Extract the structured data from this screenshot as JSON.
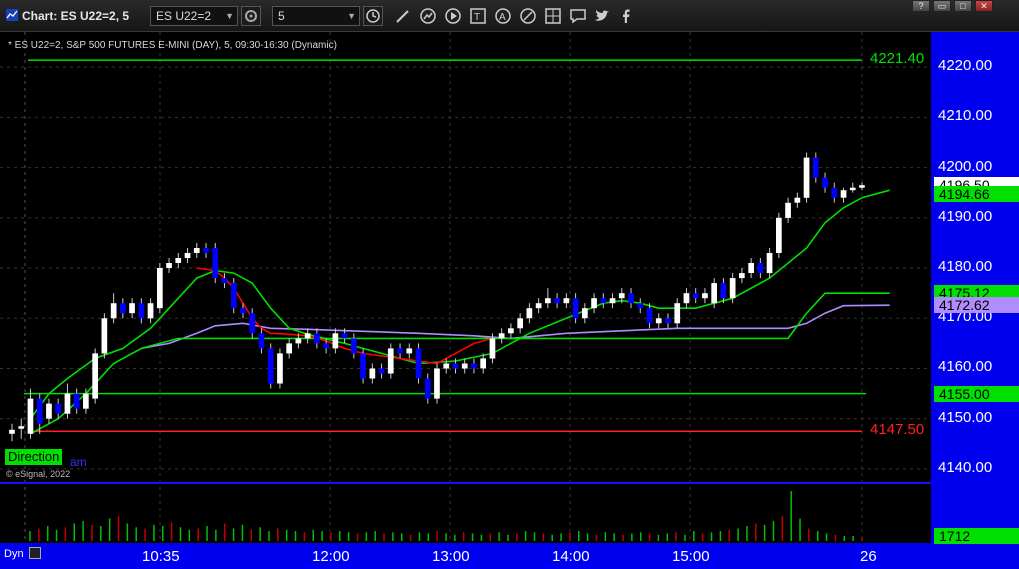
{
  "window": {
    "title": "Chart: ES U22=2, 5",
    "symbol_field": "ES U22=2",
    "interval_field": "5",
    "buttons": [
      "?",
      "▭",
      "□",
      "✕"
    ]
  },
  "chart": {
    "description": "* ES U22=2, S&P 500 FUTURES E-MINI (DAY), 5, 09:30-16:30 (Dynamic)",
    "credit": "© eSignal, 2022",
    "direction_label": "Direction",
    "direction_trail": "am",
    "dyn_label": "Dyn",
    "colors": {
      "background": "#000000",
      "axis": "#0000ee",
      "up_candle": "#ffffff",
      "down_candle": "#0000ff",
      "ma_fast": "#ff0000",
      "ma_green": "#00e000",
      "ma_purple": "#b08cff",
      "level_green": "#00e000",
      "level_red": "#ff2020"
    }
  },
  "chart_data": {
    "type": "candlestick",
    "y_ticks": [
      "4220.00",
      "4210.00",
      "4200.00",
      "4190.00",
      "4180.00",
      "4170.00",
      "4160.00",
      "4150.00",
      "4140.00"
    ],
    "ylim": [
      4137,
      4227
    ],
    "x_ticks": [
      "10:35",
      "12:00",
      "13:00",
      "14:00",
      "15:00",
      "26"
    ],
    "price_flags": [
      {
        "label": "4196.50",
        "bg": "#ffffff",
        "fg": "#000000"
      },
      {
        "label": "4194.66",
        "bg": "#00e000",
        "fg": "#000000"
      },
      {
        "label": "4175.12",
        "bg": "#00e000",
        "fg": "#000000"
      },
      {
        "label": "4172.62",
        "bg": "#b08cff",
        "fg": "#000000"
      },
      {
        "label": "4155.00",
        "bg": "#00e000",
        "fg": "#000000"
      }
    ],
    "level_lines": [
      {
        "label": "4221.40",
        "value": 4221.4,
        "color": "#00e000"
      },
      {
        "label": "4147.50",
        "value": 4147.5,
        "color": "#ff2020"
      }
    ],
    "volume_flag": "1712",
    "candles": [
      {
        "o": 4147.0,
        "c": 4147.8,
        "h": 4149.0,
        "l": 4145.5
      },
      {
        "o": 4148.0,
        "c": 4148.5,
        "h": 4150.0,
        "l": 4146.0
      },
      {
        "o": 4147.0,
        "c": 4154.0,
        "h": 4156.0,
        "l": 4146.0
      },
      {
        "o": 4154.0,
        "c": 4149.0,
        "h": 4155.0,
        "l": 4147.0
      },
      {
        "o": 4150.0,
        "c": 4153.0,
        "h": 4154.0,
        "l": 4149.0
      },
      {
        "o": 4153.0,
        "c": 4151.0,
        "h": 4154.0,
        "l": 4150.0
      },
      {
        "o": 4151.0,
        "c": 4155.0,
        "h": 4157.0,
        "l": 4150.0
      },
      {
        "o": 4155.0,
        "c": 4152.0,
        "h": 4156.0,
        "l": 4151.0
      },
      {
        "o": 4152.0,
        "c": 4155.0,
        "h": 4156.0,
        "l": 4151.0
      },
      {
        "o": 4154.0,
        "c": 4163.0,
        "h": 4164.0,
        "l": 4153.0
      },
      {
        "o": 4163.0,
        "c": 4170.0,
        "h": 4171.0,
        "l": 4162.0
      },
      {
        "o": 4170.0,
        "c": 4173.0,
        "h": 4175.0,
        "l": 4169.0
      },
      {
        "o": 4173.0,
        "c": 4171.0,
        "h": 4174.0,
        "l": 4170.0
      },
      {
        "o": 4171.0,
        "c": 4173.0,
        "h": 4174.0,
        "l": 4170.0
      },
      {
        "o": 4173.0,
        "c": 4170.0,
        "h": 4174.0,
        "l": 4169.0
      },
      {
        "o": 4170.0,
        "c": 4173.0,
        "h": 4174.0,
        "l": 4169.0
      },
      {
        "o": 4172.0,
        "c": 4180.0,
        "h": 4181.0,
        "l": 4171.0
      },
      {
        "o": 4180.0,
        "c": 4181.0,
        "h": 4182.0,
        "l": 4179.0
      },
      {
        "o": 4181.0,
        "c": 4182.0,
        "h": 4183.0,
        "l": 4180.0
      },
      {
        "o": 4182.0,
        "c": 4183.0,
        "h": 4184.0,
        "l": 4181.0
      },
      {
        "o": 4183.0,
        "c": 4184.0,
        "h": 4185.0,
        "l": 4182.0
      },
      {
        "o": 4184.0,
        "c": 4183.0,
        "h": 4185.0,
        "l": 4182.0
      },
      {
        "o": 4184.0,
        "c": 4178.0,
        "h": 4185.0,
        "l": 4177.0
      },
      {
        "o": 4178.0,
        "c": 4177.0,
        "h": 4179.0,
        "l": 4176.0
      },
      {
        "o": 4177.0,
        "c": 4172.0,
        "h": 4178.0,
        "l": 4171.0
      },
      {
        "o": 4172.0,
        "c": 4171.0,
        "h": 4173.0,
        "l": 4170.0
      },
      {
        "o": 4171.0,
        "c": 4167.0,
        "h": 4172.0,
        "l": 4166.0
      },
      {
        "o": 4167.0,
        "c": 4164.0,
        "h": 4168.0,
        "l": 4163.0
      },
      {
        "o": 4164.0,
        "c": 4157.0,
        "h": 4165.0,
        "l": 4156.0
      },
      {
        "o": 4157.0,
        "c": 4163.0,
        "h": 4164.0,
        "l": 4156.0
      },
      {
        "o": 4163.0,
        "c": 4165.0,
        "h": 4166.0,
        "l": 4162.0
      },
      {
        "o": 4165.0,
        "c": 4166.0,
        "h": 4167.0,
        "l": 4164.0
      },
      {
        "o": 4166.0,
        "c": 4167.0,
        "h": 4168.0,
        "l": 4165.0
      },
      {
        "o": 4167.0,
        "c": 4165.0,
        "h": 4168.0,
        "l": 4164.0
      },
      {
        "o": 4165.0,
        "c": 4164.0,
        "h": 4166.0,
        "l": 4163.0
      },
      {
        "o": 4164.0,
        "c": 4167.0,
        "h": 4168.0,
        "l": 4163.0
      },
      {
        "o": 4167.0,
        "c": 4166.0,
        "h": 4168.0,
        "l": 4165.0
      },
      {
        "o": 4166.0,
        "c": 4163.0,
        "h": 4167.0,
        "l": 4162.0
      },
      {
        "o": 4163.0,
        "c": 4158.0,
        "h": 4164.0,
        "l": 4157.0
      },
      {
        "o": 4158.0,
        "c": 4160.0,
        "h": 4161.0,
        "l": 4157.0
      },
      {
        "o": 4160.0,
        "c": 4159.0,
        "h": 4161.0,
        "l": 4158.0
      },
      {
        "o": 4159.0,
        "c": 4164.0,
        "h": 4165.0,
        "l": 4158.0
      },
      {
        "o": 4164.0,
        "c": 4163.0,
        "h": 4165.0,
        "l": 4162.0
      },
      {
        "o": 4163.0,
        "c": 4164.0,
        "h": 4165.0,
        "l": 4162.0
      },
      {
        "o": 4164.0,
        "c": 4158.0,
        "h": 4165.0,
        "l": 4157.0
      },
      {
        "o": 4158.0,
        "c": 4154.0,
        "h": 4159.0,
        "l": 4153.0
      },
      {
        "o": 4154.0,
        "c": 4160.0,
        "h": 4161.0,
        "l": 4153.0
      },
      {
        "o": 4160.0,
        "c": 4161.0,
        "h": 4162.0,
        "l": 4159.0
      },
      {
        "o": 4161.0,
        "c": 4160.0,
        "h": 4162.0,
        "l": 4159.0
      },
      {
        "o": 4160.0,
        "c": 4161.0,
        "h": 4162.0,
        "l": 4159.0
      },
      {
        "o": 4161.0,
        "c": 4160.0,
        "h": 4162.0,
        "l": 4159.0
      },
      {
        "o": 4160.0,
        "c": 4162.0,
        "h": 4163.0,
        "l": 4159.0
      },
      {
        "o": 4162.0,
        "c": 4166.0,
        "h": 4167.0,
        "l": 4161.0
      },
      {
        "o": 4166.0,
        "c": 4167.0,
        "h": 4168.0,
        "l": 4165.0
      },
      {
        "o": 4167.0,
        "c": 4168.0,
        "h": 4169.0,
        "l": 4166.0
      },
      {
        "o": 4168.0,
        "c": 4170.0,
        "h": 4171.0,
        "l": 4167.0
      },
      {
        "o": 4170.0,
        "c": 4172.0,
        "h": 4173.0,
        "l": 4169.0
      },
      {
        "o": 4172.0,
        "c": 4173.0,
        "h": 4174.0,
        "l": 4171.0
      },
      {
        "o": 4173.0,
        "c": 4174.0,
        "h": 4176.0,
        "l": 4172.0
      },
      {
        "o": 4174.0,
        "c": 4173.0,
        "h": 4175.0,
        "l": 4172.0
      },
      {
        "o": 4173.0,
        "c": 4174.0,
        "h": 4175.0,
        "l": 4172.0
      },
      {
        "o": 4174.0,
        "c": 4170.0,
        "h": 4175.0,
        "l": 4169.0
      },
      {
        "o": 4170.0,
        "c": 4172.0,
        "h": 4173.0,
        "l": 4169.0
      },
      {
        "o": 4172.0,
        "c": 4174.0,
        "h": 4175.0,
        "l": 4171.0
      },
      {
        "o": 4174.0,
        "c": 4173.0,
        "h": 4175.0,
        "l": 4172.0
      },
      {
        "o": 4173.0,
        "c": 4174.0,
        "h": 4175.0,
        "l": 4172.0
      },
      {
        "o": 4174.0,
        "c": 4175.0,
        "h": 4176.0,
        "l": 4173.0
      },
      {
        "o": 4175.0,
        "c": 4173.0,
        "h": 4176.0,
        "l": 4172.0
      },
      {
        "o": 4173.0,
        "c": 4172.0,
        "h": 4174.0,
        "l": 4171.0
      },
      {
        "o": 4172.0,
        "c": 4169.0,
        "h": 4173.0,
        "l": 4168.0
      },
      {
        "o": 4169.0,
        "c": 4170.0,
        "h": 4171.0,
        "l": 4168.0
      },
      {
        "o": 4170.0,
        "c": 4169.0,
        "h": 4171.0,
        "l": 4168.0
      },
      {
        "o": 4169.0,
        "c": 4173.0,
        "h": 4174.0,
        "l": 4168.0
      },
      {
        "o": 4173.0,
        "c": 4175.0,
        "h": 4176.0,
        "l": 4172.0
      },
      {
        "o": 4175.0,
        "c": 4174.0,
        "h": 4176.0,
        "l": 4173.0
      },
      {
        "o": 4174.0,
        "c": 4175.0,
        "h": 4176.0,
        "l": 4173.0
      },
      {
        "o": 4173.0,
        "c": 4177.0,
        "h": 4178.0,
        "l": 4172.0
      },
      {
        "o": 4177.0,
        "c": 4174.0,
        "h": 4178.0,
        "l": 4173.0
      },
      {
        "o": 4174.0,
        "c": 4178.0,
        "h": 4179.0,
        "l": 4173.0
      },
      {
        "o": 4178.0,
        "c": 4179.0,
        "h": 4180.0,
        "l": 4177.0
      },
      {
        "o": 4179.0,
        "c": 4181.0,
        "h": 4182.0,
        "l": 4178.0
      },
      {
        "o": 4181.0,
        "c": 4179.0,
        "h": 4182.0,
        "l": 4178.0
      },
      {
        "o": 4179.0,
        "c": 4183.0,
        "h": 4184.0,
        "l": 4178.0
      },
      {
        "o": 4183.0,
        "c": 4190.0,
        "h": 4191.0,
        "l": 4182.0
      },
      {
        "o": 4190.0,
        "c": 4193.0,
        "h": 4194.0,
        "l": 4189.0
      },
      {
        "o": 4193.0,
        "c": 4194.0,
        "h": 4195.0,
        "l": 4192.0
      },
      {
        "o": 4194.0,
        "c": 4202.0,
        "h": 4203.0,
        "l": 4193.0
      },
      {
        "o": 4202.0,
        "c": 4198.0,
        "h": 4203.0,
        "l": 4197.0
      },
      {
        "o": 4198.0,
        "c": 4196.0,
        "h": 4199.0,
        "l": 4195.0
      },
      {
        "o": 4196.0,
        "c": 4194.0,
        "h": 4197.0,
        "l": 4193.0
      },
      {
        "o": 4194.0,
        "c": 4195.5,
        "h": 4196.0,
        "l": 4193.0
      },
      {
        "o": 4195.5,
        "c": 4196.0,
        "h": 4197.0,
        "l": 4195.0
      },
      {
        "o": 4196.0,
        "c": 4196.5,
        "h": 4197.0,
        "l": 4195.5
      }
    ],
    "ma_red": [
      [
        20,
        4180
      ],
      [
        22,
        4179.5
      ],
      [
        23,
        4178
      ],
      [
        24,
        4176
      ],
      [
        25,
        4173
      ],
      [
        26,
        4170
      ],
      [
        27,
        4168
      ],
      [
        28,
        4167
      ],
      [
        30,
        4166.8
      ],
      [
        32,
        4166.5
      ],
      [
        34,
        4165.5
      ],
      [
        36,
        4164
      ],
      [
        38,
        4163
      ],
      [
        40,
        4162.5
      ],
      [
        42,
        4162
      ],
      [
        44,
        4161.5
      ],
      [
        46,
        4161
      ],
      [
        48,
        4163
      ],
      [
        50,
        4165
      ],
      [
        52,
        4166
      ]
    ],
    "ma_green": [
      [
        2,
        4150
      ],
      [
        4,
        4155
      ],
      [
        6,
        4158
      ],
      [
        9,
        4162
      ],
      [
        12,
        4164
      ],
      [
        15,
        4168
      ],
      [
        18,
        4174
      ],
      [
        20,
        4178
      ],
      [
        22,
        4179.5
      ],
      [
        24,
        4179
      ],
      [
        26,
        4177
      ],
      [
        28,
        4172
      ],
      [
        30,
        4168
      ],
      [
        32,
        4166.8
      ],
      [
        36,
        4165
      ],
      [
        40,
        4163
      ],
      [
        44,
        4161
      ],
      [
        48,
        4161.5
      ],
      [
        52,
        4163
      ],
      [
        56,
        4167
      ],
      [
        60,
        4170
      ],
      [
        64,
        4173
      ],
      [
        66,
        4173.5
      ],
      [
        68,
        4173
      ],
      [
        70,
        4172
      ],
      [
        74,
        4172
      ],
      [
        78,
        4174
      ],
      [
        82,
        4178
      ],
      [
        86,
        4184
      ],
      [
        88,
        4189
      ],
      [
        90,
        4192
      ],
      [
        92,
        4194
      ],
      [
        95,
        4195.5
      ]
    ],
    "ma_green_flat": [
      [
        2,
        4147
      ],
      [
        5,
        4150
      ],
      [
        8,
        4155
      ],
      [
        11,
        4161
      ],
      [
        14,
        4164
      ],
      [
        18,
        4166
      ],
      [
        22,
        4166
      ],
      [
        40,
        4166
      ],
      [
        60,
        4166
      ],
      [
        75,
        4166
      ],
      [
        84,
        4166
      ],
      [
        86,
        4171
      ],
      [
        88,
        4175
      ],
      [
        95,
        4175
      ]
    ],
    "ma_purple": [
      [
        14,
        4164
      ],
      [
        17,
        4165
      ],
      [
        20,
        4167
      ],
      [
        22,
        4168.5
      ],
      [
        25,
        4169
      ],
      [
        28,
        4168
      ],
      [
        32,
        4167.8
      ],
      [
        38,
        4167.4
      ],
      [
        44,
        4167
      ],
      [
        50,
        4166.5
      ],
      [
        54,
        4166
      ],
      [
        60,
        4167
      ],
      [
        66,
        4167.5
      ],
      [
        72,
        4168
      ],
      [
        78,
        4168
      ],
      [
        84,
        4168
      ],
      [
        86,
        4169
      ],
      [
        88,
        4171
      ],
      [
        90,
        4172.5
      ],
      [
        95,
        4172.6
      ]
    ],
    "support_line": 4155,
    "volume": [
      8,
      10,
      12,
      9,
      11,
      14,
      16,
      13,
      12,
      18,
      20,
      14,
      11,
      10,
      13,
      12,
      15,
      11,
      9,
      10,
      12,
      9,
      14,
      10,
      13,
      9,
      11,
      8,
      10,
      9,
      8,
      7,
      9,
      8,
      7,
      8,
      7,
      6,
      7,
      8,
      6,
      7,
      6,
      5,
      7,
      6,
      8,
      6,
      5,
      7,
      6,
      5,
      6,
      7,
      5,
      6,
      8,
      7,
      6,
      5,
      6,
      7,
      8,
      6,
      5,
      7,
      6,
      5,
      6,
      7,
      6,
      5,
      6,
      7,
      5,
      8,
      6,
      7,
      8,
      9,
      10,
      12,
      14,
      13,
      16,
      20,
      40,
      18,
      10,
      8,
      6,
      5,
      4,
      4,
      3
    ]
  }
}
